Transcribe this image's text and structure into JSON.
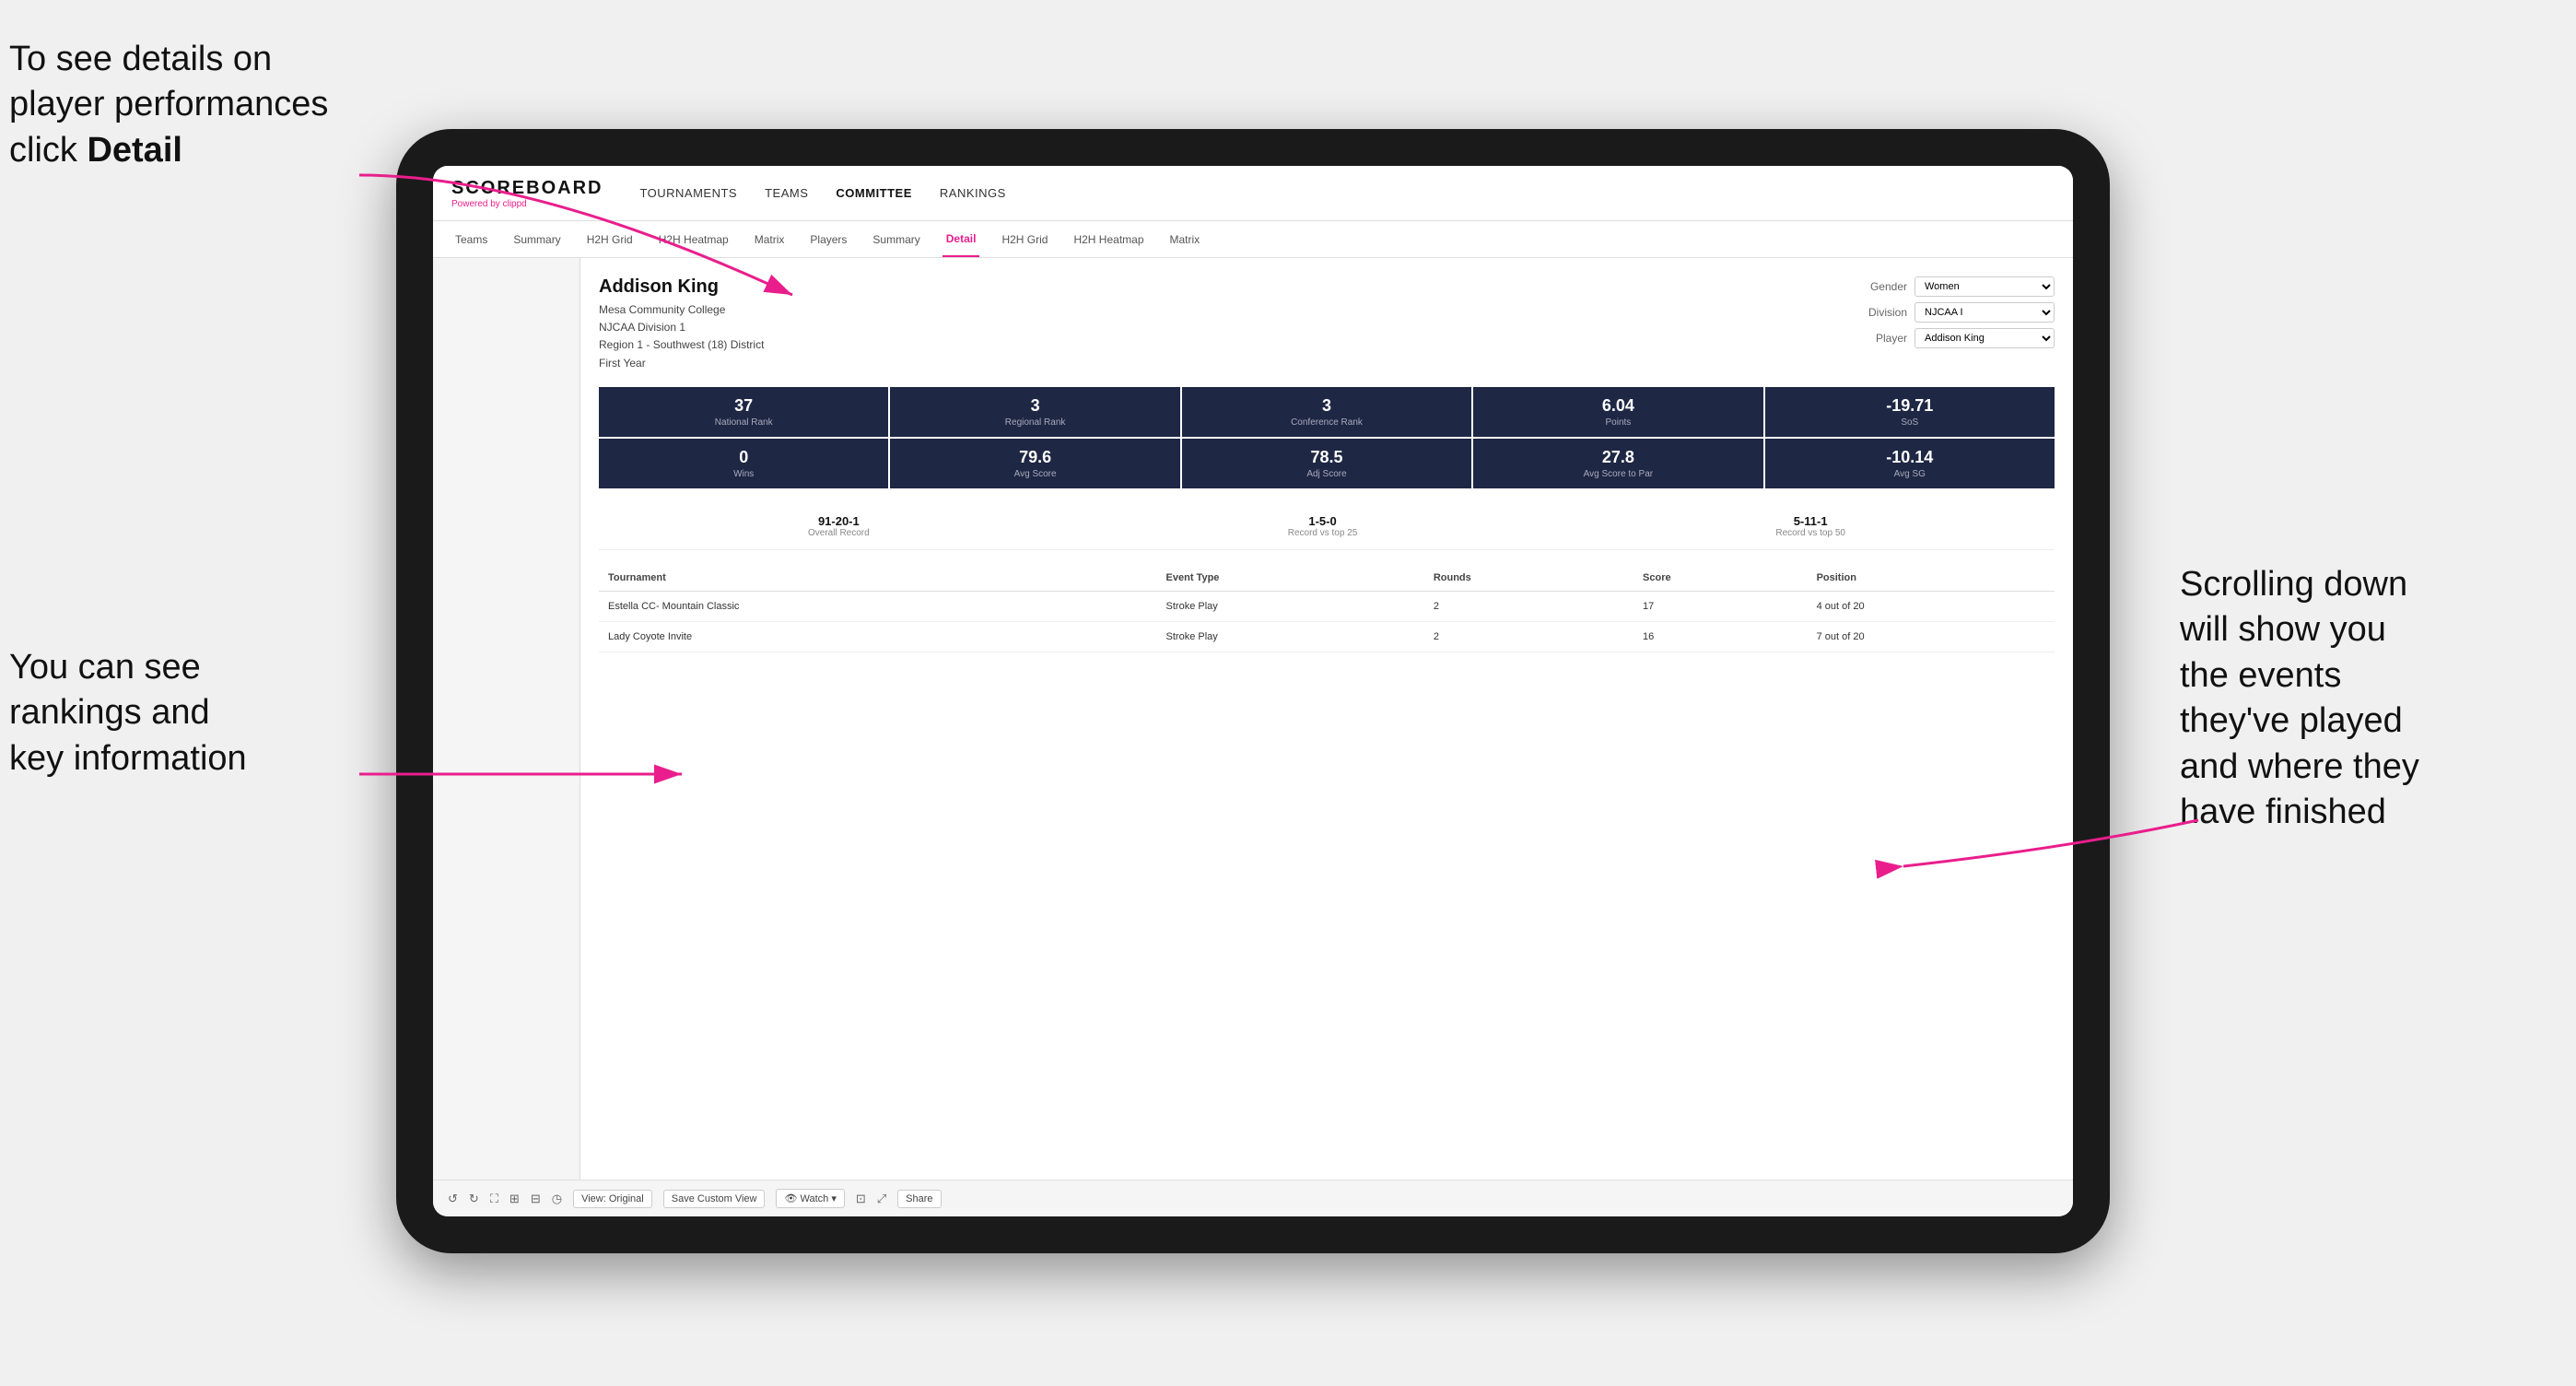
{
  "annotations": {
    "topleft": "To see details on player performances click",
    "topleft_bold": "Detail",
    "bottomleft_line1": "You can see",
    "bottomleft_line2": "rankings and",
    "bottomleft_line3": "key information",
    "bottomright_line1": "Scrolling down",
    "bottomright_line2": "will show you",
    "bottomright_line3": "the events",
    "bottomright_line4": "they've played",
    "bottomright_line5": "and where they",
    "bottomright_line6": "have finished"
  },
  "nav": {
    "logo": "SCOREBOARD",
    "powered_by": "Powered by",
    "clippd": "clippd",
    "items": [
      {
        "label": "TOURNAMENTS"
      },
      {
        "label": "TEAMS"
      },
      {
        "label": "COMMITTEE"
      },
      {
        "label": "RANKINGS"
      }
    ]
  },
  "subnav": {
    "items": [
      {
        "label": "Teams"
      },
      {
        "label": "Summary"
      },
      {
        "label": "H2H Grid"
      },
      {
        "label": "H2H Heatmap"
      },
      {
        "label": "Matrix"
      },
      {
        "label": "Players"
      },
      {
        "label": "Summary"
      },
      {
        "label": "Detail",
        "active": true
      },
      {
        "label": "H2H Grid"
      },
      {
        "label": "H2H Heatmap"
      },
      {
        "label": "Matrix"
      }
    ]
  },
  "player": {
    "name": "Addison King",
    "college": "Mesa Community College",
    "division": "NJCAA Division 1",
    "region": "Region 1 - Southwest (18) District",
    "year": "First Year",
    "controls": {
      "gender_label": "Gender",
      "gender_value": "Women",
      "division_label": "Division",
      "division_value": "NJCAA I",
      "player_label": "Player",
      "player_value": "Addison King"
    }
  },
  "stats_row1": [
    {
      "value": "37",
      "label": "National Rank"
    },
    {
      "value": "3",
      "label": "Regional Rank"
    },
    {
      "value": "3",
      "label": "Conference Rank"
    },
    {
      "value": "6.04",
      "label": "Points"
    },
    {
      "value": "-19.71",
      "label": "SoS"
    }
  ],
  "stats_row2": [
    {
      "value": "0",
      "label": "Wins"
    },
    {
      "value": "79.6",
      "label": "Avg Score"
    },
    {
      "value": "78.5",
      "label": "Adj Score"
    },
    {
      "value": "27.8",
      "label": "Avg Score to Par"
    },
    {
      "value": "-10.14",
      "label": "Avg SG"
    }
  ],
  "records": [
    {
      "value": "91-20-1",
      "label": "Overall Record"
    },
    {
      "value": "1-5-0",
      "label": "Record vs top 25"
    },
    {
      "value": "5-11-1",
      "label": "Record vs top 50"
    }
  ],
  "table": {
    "headers": [
      "Tournament",
      "Event Type",
      "Rounds",
      "Score",
      "Position"
    ],
    "rows": [
      {
        "tournament": "Estella CC- Mountain Classic",
        "event_type": "Stroke Play",
        "rounds": "2",
        "score": "17",
        "position": "4 out of 20"
      },
      {
        "tournament": "Lady Coyote Invite",
        "event_type": "Stroke Play",
        "rounds": "2",
        "score": "16",
        "position": "7 out of 20"
      }
    ]
  },
  "toolbar": {
    "buttons": [
      {
        "label": "↺",
        "type": "icon"
      },
      {
        "label": "↻",
        "type": "icon"
      },
      {
        "label": "⛶",
        "type": "icon"
      },
      {
        "label": "⊞",
        "type": "icon"
      },
      {
        "label": "⊟",
        "type": "icon"
      },
      {
        "label": "◷",
        "type": "icon"
      },
      {
        "label": "View: Original",
        "type": "text"
      },
      {
        "label": "Save Custom View",
        "type": "text"
      },
      {
        "label": "👁 Watch ▾",
        "type": "text"
      },
      {
        "label": "⊡",
        "type": "icon"
      },
      {
        "label": "⤢",
        "type": "icon"
      },
      {
        "label": "Share",
        "type": "text"
      }
    ]
  }
}
